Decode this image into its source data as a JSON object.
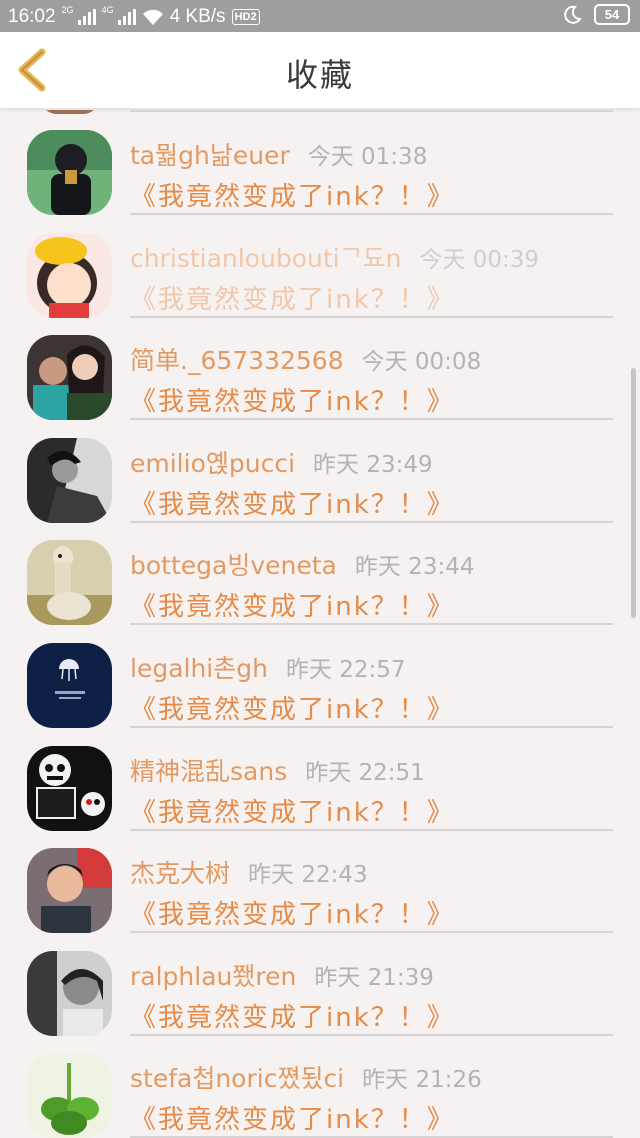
{
  "status_bar": {
    "time": "16:02",
    "sim1_label": "2G",
    "sim2_label": "4G",
    "speed": "4 KB/s",
    "hd_label": "HD2",
    "battery": "54"
  },
  "header": {
    "title": "收藏"
  },
  "items": [
    {
      "name": "ta뭚gh낢euer",
      "time": "今天 01:38",
      "message": "《我竟然变成了ink？！》",
      "avatar": "dark-figure-avatar"
    },
    {
      "name": "christianlouboutiᄀ됴n",
      "time": "今天 00:39",
      "message": "《我竟然变成了ink？！》",
      "avatar": "cartoon-girl-avatar"
    },
    {
      "name": "简单._657332568",
      "time": "今天 00:08",
      "message": "《我竟然变成了ink？！》",
      "avatar": "couple-photo-avatar"
    },
    {
      "name": "emilio옍pucci",
      "time": "昨天 23:49",
      "message": "《我竟然变成了ink？！》",
      "avatar": "bw-portrait-avatar"
    },
    {
      "name": "bottega빙veneta",
      "time": "昨天 23:44",
      "message": "《我竟然变成了ink？！》",
      "avatar": "alpaca-avatar"
    },
    {
      "name": "legalhi촌gh",
      "time": "昨天 22:57",
      "message": "《我竟然变成了ink？！》",
      "avatar": "jellyfish-avatar"
    },
    {
      "name": "精神混乱sans",
      "time": "昨天 22:51",
      "message": "《我竟然变成了ink？！》",
      "avatar": "skeleton-avatar"
    },
    {
      "name": "杰克大树",
      "time": "昨天 22:43",
      "message": "《我竟然变成了ink？！》",
      "avatar": "man-selfie-avatar"
    },
    {
      "name": "ralphlau쬈ren",
      "time": "昨天 21:39",
      "message": "《我竟然变成了ink？！》",
      "avatar": "child-bw-avatar"
    },
    {
      "name": "stefa첩noric쪘됬ci",
      "time": "昨天 21:26",
      "message": "《我竟然变成了ink？！》",
      "avatar": "clover-avatar"
    }
  ]
}
